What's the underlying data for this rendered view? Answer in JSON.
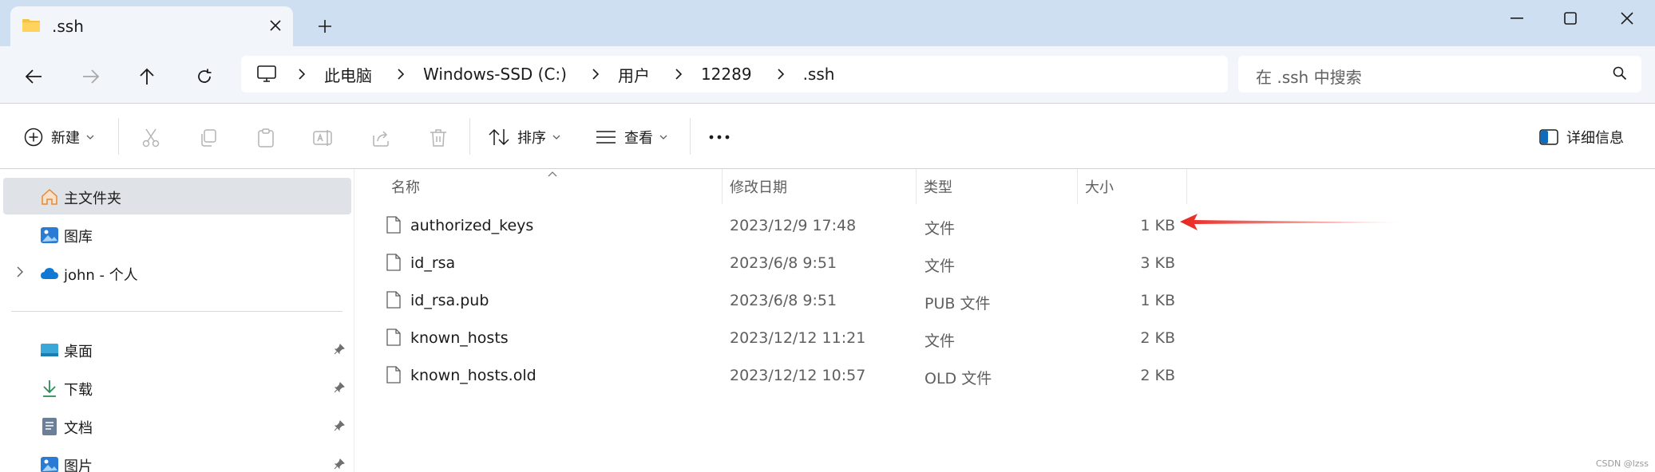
{
  "window": {
    "tab_title": ".ssh",
    "new_tab_label": "+",
    "controls": [
      "minimize-icon",
      "maximize-icon",
      "close-icon"
    ]
  },
  "address": {
    "breadcrumbs": [
      "此电脑",
      "Windows-SSD (C:)",
      "用户",
      "12289",
      ".ssh"
    ],
    "search_placeholder": "在 .ssh 中搜索"
  },
  "toolbar": {
    "new_label": "新建",
    "sort_label": "排序",
    "view_label": "查看",
    "more_label": "···",
    "details_label": "详细信息"
  },
  "sidebar": {
    "items": [
      {
        "label": "主文件夹",
        "icon": "home-icon",
        "selected": true
      },
      {
        "label": "图库",
        "icon": "gallery-icon"
      },
      {
        "label": "john - 个人",
        "icon": "onedrive-cloud-icon",
        "expandable": true
      }
    ],
    "quick_access": [
      {
        "label": "桌面",
        "icon": "desktop-icon",
        "pinned": true
      },
      {
        "label": "下载",
        "icon": "download-icon",
        "pinned": true
      },
      {
        "label": "文档",
        "icon": "document-icon",
        "pinned": true
      },
      {
        "label": "图片",
        "icon": "pictures-icon",
        "pinned": true
      }
    ]
  },
  "columns": {
    "name": "名称",
    "date": "修改日期",
    "type": "类型",
    "size": "大小"
  },
  "files": [
    {
      "name": "authorized_keys",
      "date": "2023/12/9 17:48",
      "type": "文件",
      "size": "1 KB"
    },
    {
      "name": "id_rsa",
      "date": "2023/6/8 9:51",
      "type": "文件",
      "size": "3 KB"
    },
    {
      "name": "id_rsa.pub",
      "date": "2023/6/8 9:51",
      "type": "PUB 文件",
      "size": "1 KB"
    },
    {
      "name": "known_hosts",
      "date": "2023/12/12 11:21",
      "type": "文件",
      "size": "2 KB"
    },
    {
      "name": "known_hosts.old",
      "date": "2023/12/12 10:57",
      "type": "OLD 文件",
      "size": "2 KB"
    }
  ],
  "annotation": {
    "color": "#e8251f",
    "target": "authorized_keys"
  },
  "watermark": "CSDN @lzss",
  "colors": {
    "tabstrip": "#cddff0",
    "toolbar": "#f2f6fb",
    "selected": "#dfe3e8"
  }
}
